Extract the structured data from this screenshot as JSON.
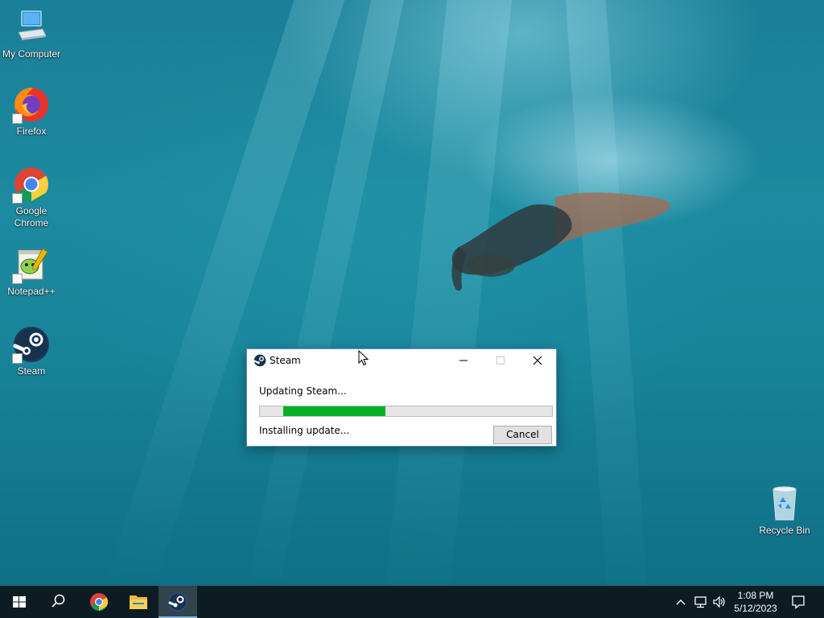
{
  "desktop": {
    "icons": [
      {
        "label": "My Computer",
        "icon": "computer-icon"
      },
      {
        "label": "Firefox",
        "icon": "firefox-icon"
      },
      {
        "label": "Google Chrome",
        "icon": "chrome-icon"
      },
      {
        "label": "Notepad++",
        "icon": "notepadpp-icon"
      },
      {
        "label": "Steam",
        "icon": "steam-icon"
      },
      {
        "label": "Recycle Bin",
        "icon": "recycle-bin-icon"
      }
    ]
  },
  "dialog": {
    "title": "Steam",
    "status": "Updating Steam...",
    "detail": "Installing update...",
    "cancel_label": "Cancel",
    "progress": {
      "start": 0.08,
      "end": 0.43
    },
    "progress_color": "#06b025"
  },
  "taskbar": {
    "time": "1:08 PM",
    "date": "5/12/2023",
    "pinned": [
      "windows-start-icon",
      "search-icon",
      "chrome-icon",
      "file-explorer-icon",
      "steam-icon"
    ],
    "active": "steam-icon"
  },
  "colors": {
    "taskbar": "#0d1b23",
    "progress": "#06b025"
  }
}
